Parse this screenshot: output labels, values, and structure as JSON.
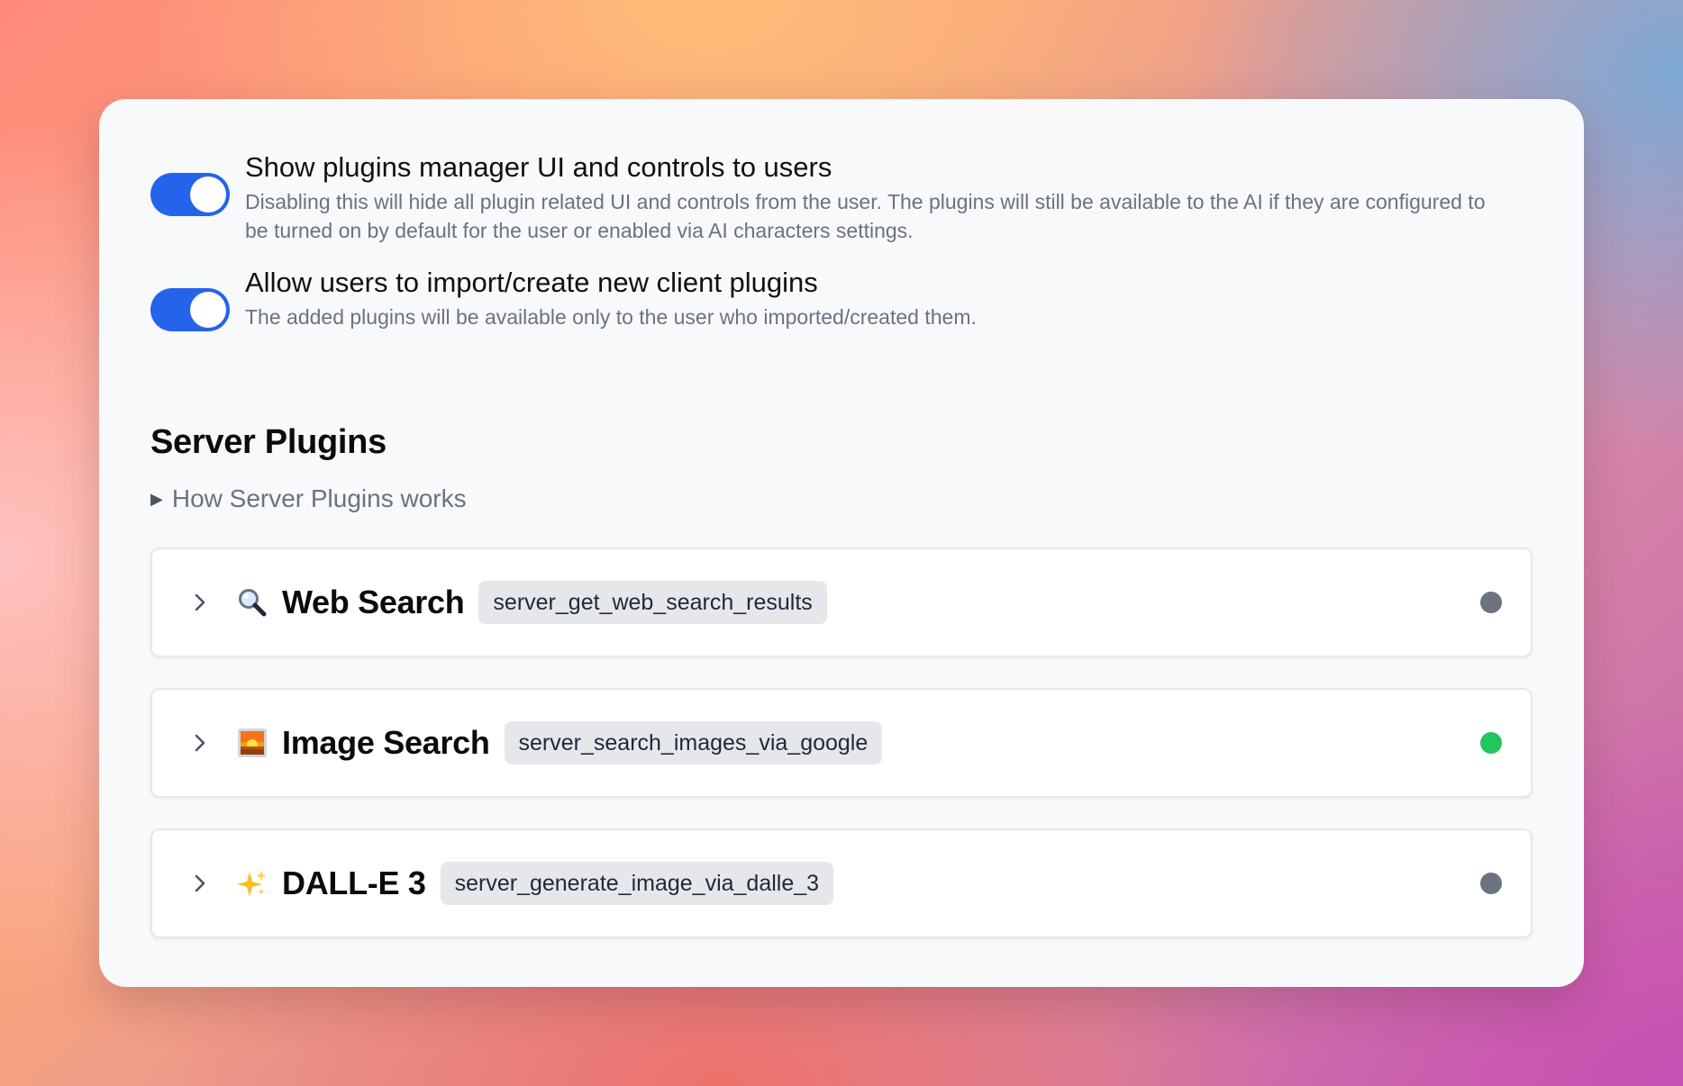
{
  "settings": [
    {
      "title": "Show plugins manager UI and controls to users",
      "description": "Disabling this will hide all plugin related UI and controls from the user. The plugins will still be available to the AI if they are configured to be turned on by default for the user or enabled via AI characters settings.",
      "enabled": true
    },
    {
      "title": "Allow users to import/create new client plugins",
      "description": "The added plugins will be available only to the user who imported/created them.",
      "enabled": true
    }
  ],
  "server_plugins": {
    "title": "Server Plugins",
    "help_toggle": "How Server Plugins works",
    "items": [
      {
        "name": "Web Search",
        "icon": "magnifying-glass-icon",
        "function": "server_get_web_search_results",
        "status": "inactive",
        "status_color": "#6b7280"
      },
      {
        "name": "Image Search",
        "icon": "sunrise-image-icon",
        "function": "server_search_images_via_google",
        "status": "active",
        "status_color": "#22c55e"
      },
      {
        "name": "DALL-E 3",
        "icon": "sparkles-icon",
        "function": "server_generate_image_via_dalle_3",
        "status": "inactive",
        "status_color": "#6b7280"
      }
    ]
  },
  "colors": {
    "toggle_on": "#2563eb",
    "badge_bg": "#e5e7eb"
  }
}
